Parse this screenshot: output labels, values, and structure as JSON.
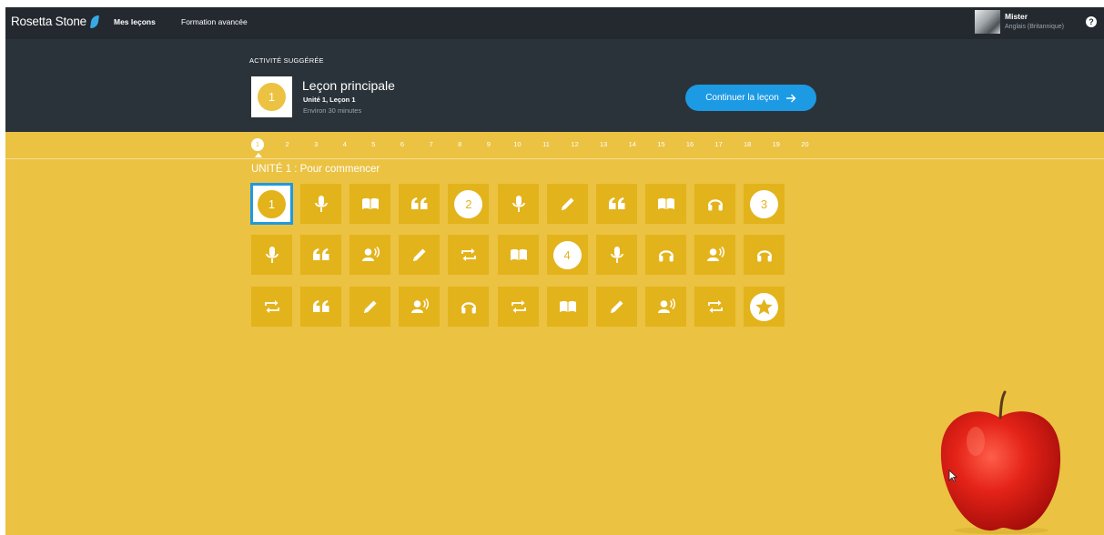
{
  "nav": {
    "brand": "Rosetta Stone",
    "tabs": [
      "Mes leçons",
      "Formation avancée"
    ],
    "user": {
      "name": "Mister",
      "language": "Anglais (Britannique)"
    },
    "help": "?"
  },
  "suggested": {
    "label": "ACTIVITÉ SUGGÉRÉE",
    "badge": "1",
    "title": "Leçon principale",
    "subtitle": "Unité 1, Leçon 1",
    "duration": "Environ 30 minutes",
    "button": "Continuer la leçon",
    "button_icon": "arrow-right-icon"
  },
  "units": [
    "1",
    "2",
    "3",
    "4",
    "5",
    "6",
    "7",
    "8",
    "9",
    "10",
    "11",
    "12",
    "13",
    "14",
    "15",
    "16",
    "17",
    "18",
    "19",
    "20"
  ],
  "active_unit": "1",
  "unit_heading": "UNITÉ 1 : Pour commencer",
  "tiles": [
    [
      {
        "type": "number",
        "label": "1",
        "selected": true
      },
      {
        "type": "icon",
        "icon": "microphone-icon"
      },
      {
        "type": "icon",
        "icon": "book-icon"
      },
      {
        "type": "icon",
        "icon": "quote-icon"
      },
      {
        "type": "number",
        "label": "2"
      },
      {
        "type": "icon",
        "icon": "microphone-icon"
      },
      {
        "type": "icon",
        "icon": "pencil-icon"
      },
      {
        "type": "icon",
        "icon": "quote-icon"
      },
      {
        "type": "icon",
        "icon": "book-icon"
      },
      {
        "type": "icon",
        "icon": "headphones-icon"
      },
      {
        "type": "number",
        "label": "3"
      }
    ],
    [
      {
        "type": "icon",
        "icon": "microphone-icon"
      },
      {
        "type": "icon",
        "icon": "quote-icon"
      },
      {
        "type": "icon",
        "icon": "speaker-person-icon"
      },
      {
        "type": "icon",
        "icon": "pencil-icon"
      },
      {
        "type": "icon",
        "icon": "repeat-icon"
      },
      {
        "type": "icon",
        "icon": "book-icon"
      },
      {
        "type": "number",
        "label": "4"
      },
      {
        "type": "icon",
        "icon": "microphone-icon"
      },
      {
        "type": "icon",
        "icon": "headphones-icon"
      },
      {
        "type": "icon",
        "icon": "speaker-person-icon"
      },
      {
        "type": "icon",
        "icon": "headphones-icon"
      }
    ],
    [
      {
        "type": "icon",
        "icon": "repeat-icon"
      },
      {
        "type": "icon",
        "icon": "quote-icon"
      },
      {
        "type": "icon",
        "icon": "pencil-icon"
      },
      {
        "type": "icon",
        "icon": "speaker-person-icon"
      },
      {
        "type": "icon",
        "icon": "headphones-icon"
      },
      {
        "type": "icon",
        "icon": "repeat-icon"
      },
      {
        "type": "icon",
        "icon": "book-icon"
      },
      {
        "type": "icon",
        "icon": "pencil-icon"
      },
      {
        "type": "icon",
        "icon": "speaker-person-icon"
      },
      {
        "type": "icon",
        "icon": "repeat-icon"
      },
      {
        "type": "icon",
        "icon": "star-icon"
      }
    ]
  ],
  "colors": {
    "background": "#ebc242",
    "tile": "#e3b31b",
    "nav": "#23292f",
    "band": "#2b333a",
    "accent": "#1c9ae4"
  }
}
